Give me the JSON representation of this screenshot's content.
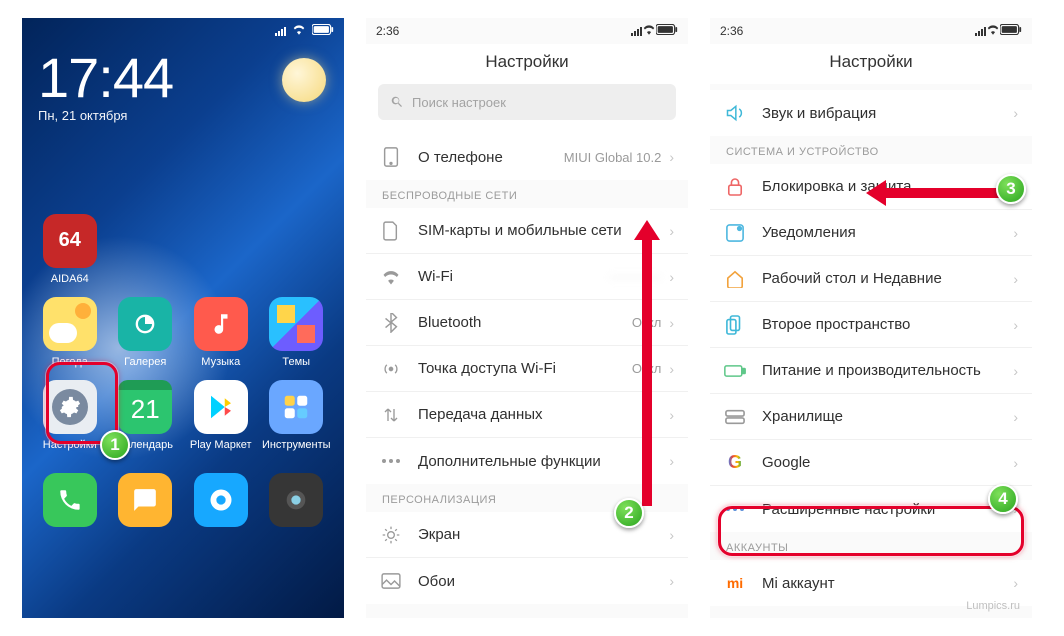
{
  "markers": {
    "m1": "1",
    "m2": "2",
    "m3": "3",
    "m4": "4"
  },
  "watermark": "Lumpics.ru",
  "home": {
    "time": "17:44",
    "date": "Пн, 21 октября",
    "apps": {
      "aida": {
        "badge": "64",
        "label": "AIDA64"
      },
      "weather": "Погода",
      "gallery": "Галерея",
      "music": "Музыка",
      "themes": "Темы",
      "settings": "Настройки",
      "calendar": {
        "day": "21",
        "label": "Календарь"
      },
      "play": "Play Маркет",
      "tools": "Инструменты"
    }
  },
  "screen2": {
    "status_time": "2:36",
    "title": "Настройки",
    "search_placeholder": "Поиск настроек",
    "about": {
      "label": "О телефоне",
      "value": "MIUI Global 10.2"
    },
    "section_wireless": "БЕСПРОВОДНЫЕ СЕТИ",
    "items_wireless": [
      {
        "label": "SIM-карты и мобильные сети"
      },
      {
        "label": "Wi-Fi",
        "value_blurred": true
      },
      {
        "label": "Bluetooth",
        "value": "Откл"
      },
      {
        "label": "Точка доступа Wi-Fi",
        "value": "Откл"
      },
      {
        "label": "Передача данных"
      },
      {
        "label": "Дополнительные функции"
      }
    ],
    "section_personalization": "ПЕРСОНАЛИЗАЦИЯ",
    "items_personalization": [
      {
        "label": "Экран"
      },
      {
        "label": "Обои"
      }
    ]
  },
  "screen3": {
    "status_time": "2:36",
    "title": "Настройки",
    "sound": "Звук и вибрация",
    "section_system": "СИСТЕМА И УСТРОЙСТВО",
    "items_system": [
      "Блокировка и защита",
      "Уведомления",
      "Рабочий стол и Недавние",
      "Второе пространство",
      "Питание и производительность",
      "Хранилище",
      "Google",
      "Расширенные настройки"
    ],
    "section_accounts": "АККАУНТЫ",
    "mi_account": "Mi аккаунт"
  }
}
